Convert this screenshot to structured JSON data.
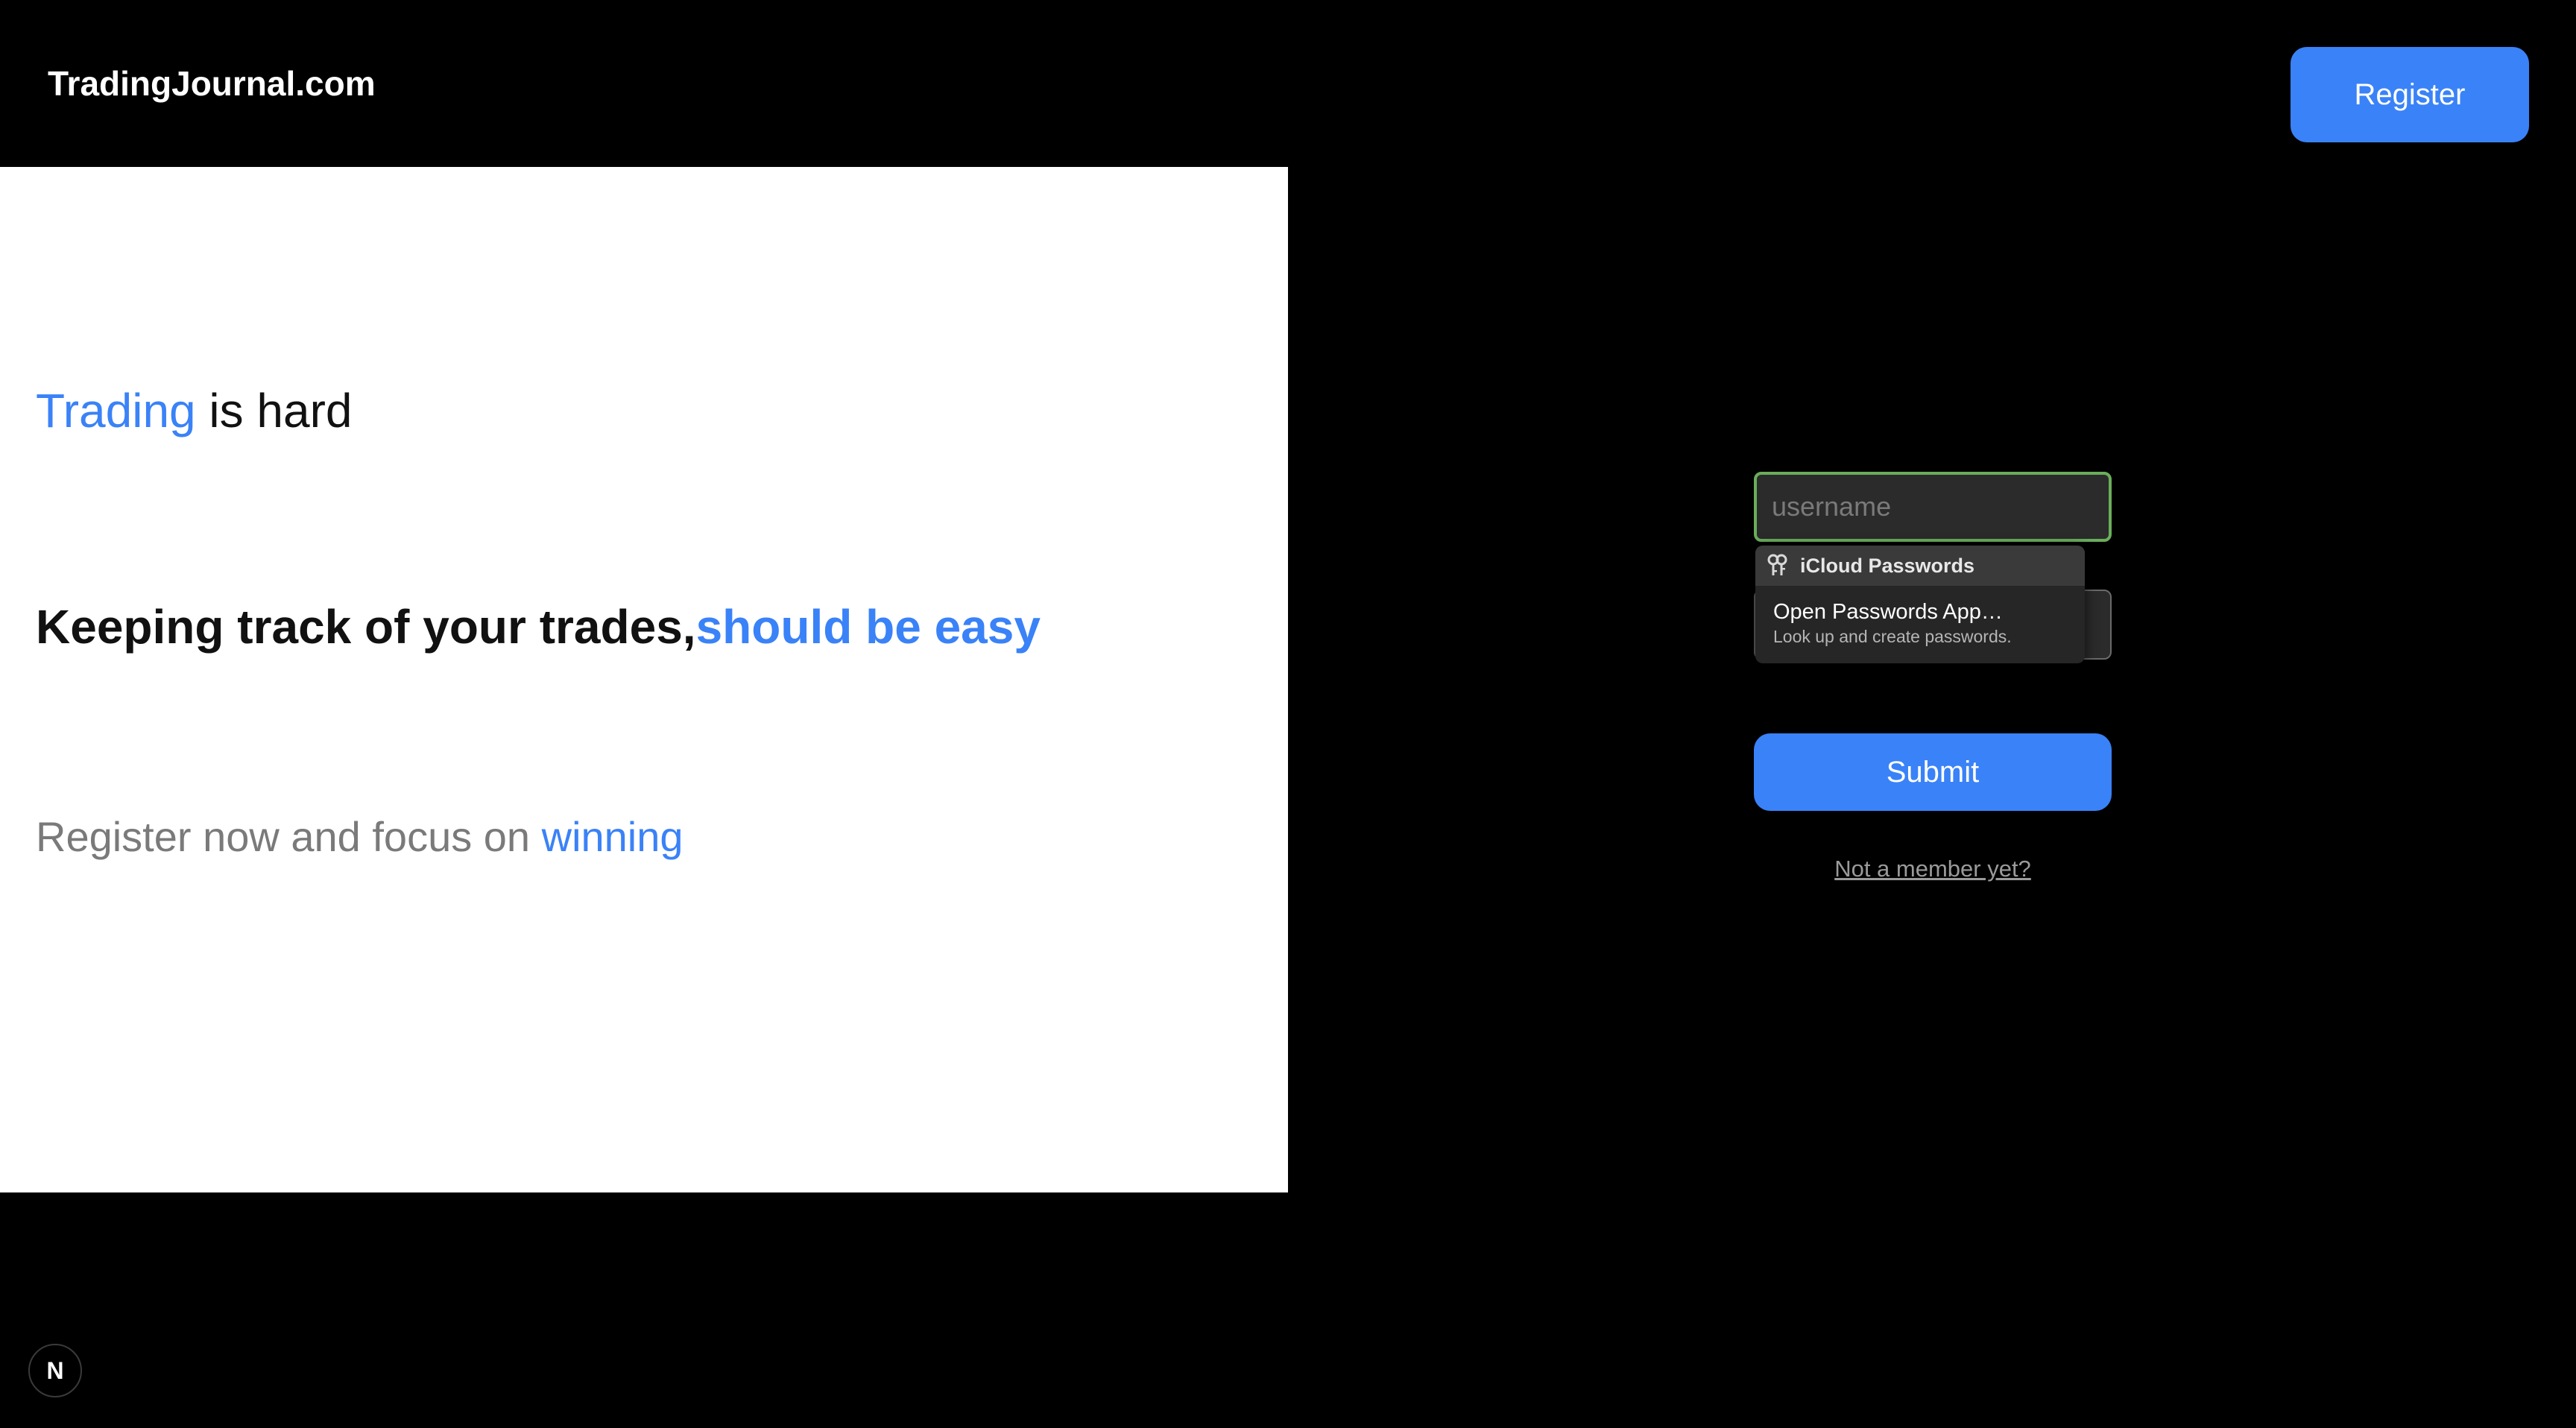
{
  "header": {
    "brand": "TradingJournal.com",
    "register_label": "Register"
  },
  "hero": {
    "line1_accent": "Trading",
    "line1_rest": " is hard",
    "line2_main": "Keeping track of your trades,",
    "line2_accent": "should be easy",
    "line3_main": "Register now and focus on ",
    "line3_accent": "winning"
  },
  "form": {
    "username_placeholder": "username",
    "username_value": "",
    "password_value": "",
    "submit_label": "Submit",
    "not_member_label": "Not a member yet?"
  },
  "autofill": {
    "header_label": "iCloud Passwords",
    "item_title": "Open Passwords App…",
    "item_subtitle": "Look up and create passwords.",
    "icon": "key-icon"
  },
  "badge": {
    "letter": "N"
  },
  "colors": {
    "accent": "#3a82f7",
    "background": "#000000",
    "hero_background": "#ffffff",
    "focus_border": "#6aae5b"
  }
}
